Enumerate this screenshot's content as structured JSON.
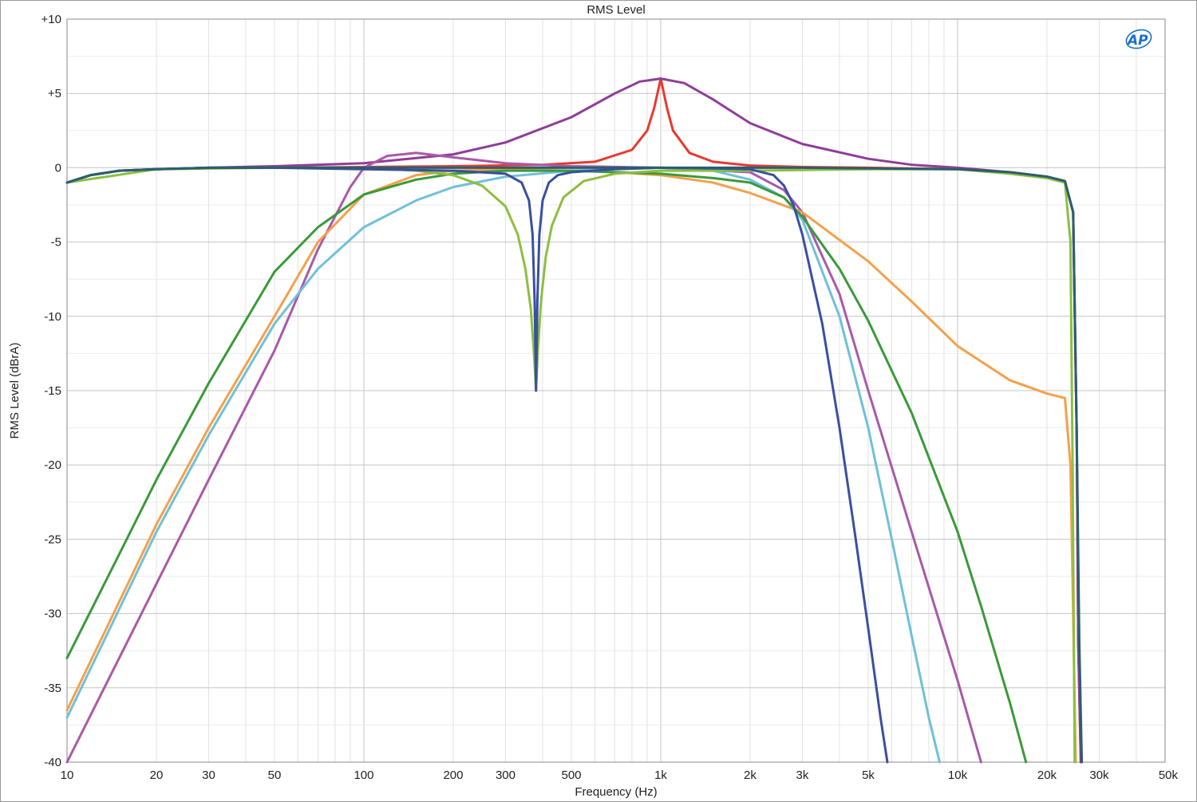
{
  "chart_data": {
    "type": "line",
    "title": "RMS Level",
    "xlabel": "Frequency (Hz)",
    "ylabel": "RMS Level (dBrA)",
    "xscale": "log",
    "xlim": [
      10,
      50000
    ],
    "ylim": [
      -40,
      10
    ],
    "grid": true,
    "logo": "AP",
    "yticks": [
      {
        "value": 10,
        "label": "+10"
      },
      {
        "value": 5,
        "label": "+5"
      },
      {
        "value": 0,
        "label": "0"
      },
      {
        "value": -5,
        "label": "-5"
      },
      {
        "value": -10,
        "label": "-10"
      },
      {
        "value": -15,
        "label": "-15"
      },
      {
        "value": -20,
        "label": "-20"
      },
      {
        "value": -25,
        "label": "-25"
      },
      {
        "value": -30,
        "label": "-30"
      },
      {
        "value": -35,
        "label": "-35"
      },
      {
        "value": -40,
        "label": "-40"
      }
    ],
    "xticks": [
      {
        "value": 10,
        "label": "10"
      },
      {
        "value": 20,
        "label": "20"
      },
      {
        "value": 30,
        "label": "30"
      },
      {
        "value": 50,
        "label": "50"
      },
      {
        "value": 100,
        "label": "100"
      },
      {
        "value": 200,
        "label": "200"
      },
      {
        "value": 300,
        "label": "300"
      },
      {
        "value": 500,
        "label": "500"
      },
      {
        "value": 1000,
        "label": "1k"
      },
      {
        "value": 2000,
        "label": "2k"
      },
      {
        "value": 3000,
        "label": "3k"
      },
      {
        "value": 5000,
        "label": "5k"
      },
      {
        "value": 10000,
        "label": "10k"
      },
      {
        "value": 20000,
        "label": "20k"
      },
      {
        "value": 30000,
        "label": "30k"
      },
      {
        "value": 50000,
        "label": "50k"
      }
    ],
    "series": [
      {
        "color": "#e8392f",
        "x": [
          10,
          12,
          15,
          20,
          30,
          50,
          100,
          200,
          400,
          600,
          800,
          900,
          950,
          1000,
          1050,
          1100,
          1250,
          1500,
          2000,
          3000,
          5000,
          10000,
          15000,
          20000,
          23000,
          24500,
          25200,
          25500,
          26000
        ],
        "y": [
          -1.0,
          -0.5,
          -0.2,
          -0.1,
          0.0,
          0.0,
          0.05,
          0.1,
          0.2,
          0.4,
          1.2,
          2.5,
          4.0,
          6.0,
          4.0,
          2.5,
          1.0,
          0.4,
          0.15,
          0.05,
          0.0,
          -0.1,
          -0.3,
          -0.6,
          -0.9,
          -3.0,
          -18.0,
          -32.0,
          -40.0
        ]
      },
      {
        "color": "#8e3d98",
        "x": [
          10,
          12,
          15,
          20,
          30,
          50,
          100,
          200,
          300,
          500,
          700,
          850,
          1000,
          1200,
          1500,
          2000,
          3000,
          5000,
          7000,
          10000,
          15000,
          20000,
          23000,
          24500,
          25200,
          25500,
          26000
        ],
        "y": [
          -1.0,
          -0.5,
          -0.2,
          -0.1,
          0.0,
          0.1,
          0.3,
          0.9,
          1.7,
          3.4,
          5.0,
          5.8,
          6.0,
          5.7,
          4.6,
          3.0,
          1.6,
          0.6,
          0.2,
          0.0,
          -0.3,
          -0.6,
          -0.9,
          -3.0,
          -18.0,
          -32.0,
          -40.0
        ]
      },
      {
        "color": "#a85aa8",
        "x": [
          10,
          20,
          30,
          50,
          70,
          90,
          100,
          120,
          150,
          200,
          300,
          500,
          1000,
          2000,
          2600,
          3000,
          4000,
          5000,
          7000,
          10000,
          12000
        ],
        "y": [
          -40.0,
          -28.0,
          -21.0,
          -12.3,
          -5.5,
          -1.3,
          0.0,
          0.8,
          1.0,
          0.7,
          0.3,
          0.1,
          0.0,
          -0.3,
          -1.5,
          -3.0,
          -8.5,
          -15.0,
          -24.5,
          -34.5,
          -40.0
        ]
      },
      {
        "color": "#f5a04a",
        "x": [
          10,
          20,
          30,
          50,
          70,
          100,
          150,
          200,
          300,
          500,
          700,
          1000,
          1500,
          2000,
          3000,
          5000,
          7000,
          10000,
          15000,
          20000,
          23000,
          24000,
          24500,
          25000
        ],
        "y": [
          -36.5,
          -24.0,
          -17.5,
          -10.0,
          -5.0,
          -1.8,
          -0.5,
          -0.2,
          -0.1,
          -0.2,
          -0.3,
          -0.5,
          -1.0,
          -1.7,
          -3.0,
          -6.3,
          -9.0,
          -12.0,
          -14.3,
          -15.2,
          -15.5,
          -20.0,
          -30.0,
          -40.0
        ]
      },
      {
        "color": "#70c0d8",
        "x": [
          10,
          20,
          30,
          50,
          70,
          100,
          150,
          200,
          300,
          500,
          700,
          1000,
          1500,
          2000,
          2600,
          3000,
          4000,
          5000,
          6000,
          7000,
          8000,
          8700
        ],
        "y": [
          -37.0,
          -24.5,
          -18.0,
          -10.5,
          -6.8,
          -4.0,
          -2.2,
          -1.3,
          -0.6,
          -0.2,
          -0.1,
          0.0,
          -0.2,
          -0.8,
          -2.0,
          -3.5,
          -10.0,
          -17.5,
          -25.0,
          -31.5,
          -37.0,
          -40.0
        ]
      },
      {
        "color": "#3a9a3a",
        "x": [
          10,
          15,
          20,
          30,
          50,
          70,
          100,
          150,
          200,
          300,
          500,
          700,
          1000,
          1500,
          2000,
          2600,
          3000,
          4000,
          5000,
          7000,
          10000,
          12000,
          15000,
          17000
        ],
        "y": [
          -33.0,
          -26.0,
          -21.0,
          -14.5,
          -7.0,
          -4.0,
          -1.8,
          -0.8,
          -0.4,
          -0.2,
          -0.2,
          -0.3,
          -0.4,
          -0.7,
          -1.0,
          -2.0,
          -3.3,
          -6.8,
          -10.3,
          -16.5,
          -24.5,
          -29.5,
          -36.0,
          -40.0
        ]
      },
      {
        "color": "#8cbf3f",
        "x": [
          10,
          20,
          50,
          100,
          150,
          200,
          250,
          300,
          330,
          350,
          365,
          375,
          380,
          385,
          395,
          410,
          430,
          470,
          550,
          700,
          1000,
          2000,
          5000,
          10000,
          15000,
          20000,
          23000,
          24000,
          24400,
          24800
        ],
        "y": [
          -1.0,
          -0.1,
          0.0,
          0.0,
          -0.2,
          -0.5,
          -1.2,
          -2.6,
          -4.5,
          -6.8,
          -9.5,
          -12.8,
          -15.0,
          -12.5,
          -9.0,
          -6.0,
          -3.9,
          -2.0,
          -0.9,
          -0.4,
          -0.2,
          -0.2,
          -0.1,
          -0.1,
          -0.4,
          -0.7,
          -1.0,
          -5.0,
          -20.0,
          -40.0
        ]
      },
      {
        "color": "#3a4fa0",
        "x": [
          10,
          12,
          15,
          20,
          30,
          50,
          100,
          200,
          300,
          340,
          360,
          370,
          376,
          380,
          384,
          390,
          400,
          420,
          450,
          500,
          700,
          1000,
          1500,
          2000,
          2400,
          2600,
          2800,
          3000,
          3500,
          4000,
          4500,
          5000,
          5500,
          5800
        ],
        "y": [
          -1.0,
          -0.5,
          -0.2,
          -0.1,
          0.0,
          0.0,
          -0.1,
          -0.2,
          -0.4,
          -1.0,
          -2.2,
          -4.5,
          -9.0,
          -15.0,
          -9.0,
          -4.5,
          -2.2,
          -1.0,
          -0.5,
          -0.3,
          -0.1,
          0.0,
          -0.05,
          -0.1,
          -0.5,
          -1.2,
          -2.5,
          -4.5,
          -10.5,
          -17.5,
          -24.5,
          -31.0,
          -37.0,
          -40.0
        ]
      },
      {
        "color": "#2a5f6f",
        "x": [
          10,
          12,
          15,
          20,
          30,
          50,
          100,
          300,
          1000,
          3000,
          10000,
          15000,
          20000,
          23000,
          24500,
          25200,
          25700,
          26200
        ],
        "y": [
          -1.0,
          -0.5,
          -0.2,
          -0.1,
          0.0,
          0.0,
          0.0,
          0.0,
          0.0,
          0.0,
          -0.1,
          -0.3,
          -0.6,
          -0.9,
          -3.0,
          -18.0,
          -32.0,
          -40.0
        ]
      }
    ]
  }
}
